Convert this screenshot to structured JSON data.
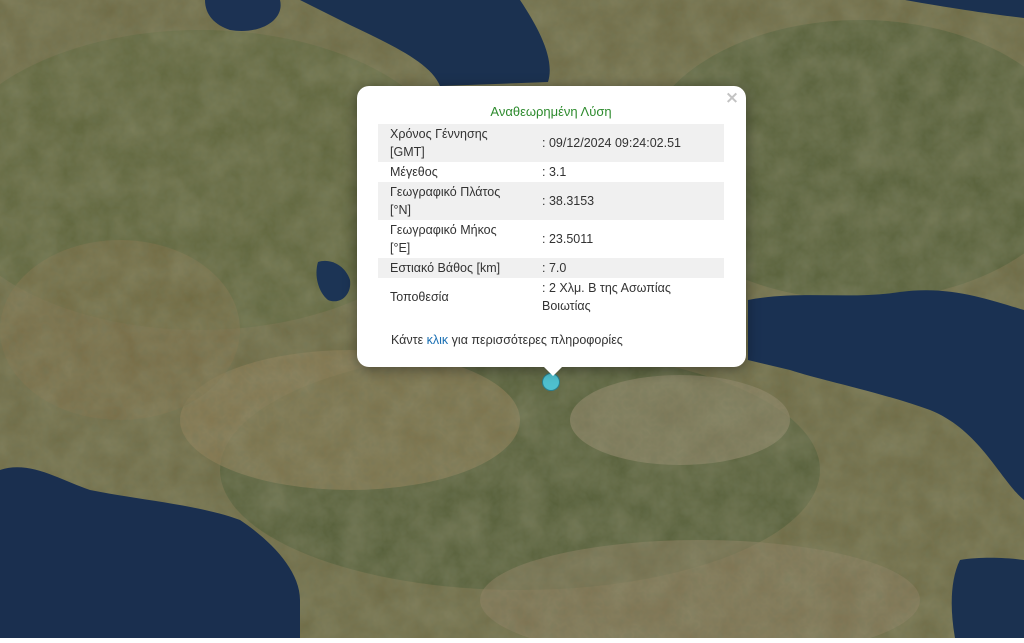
{
  "popup": {
    "title": "Αναθεωρημένη Λύση",
    "close_symbol": "×",
    "rows": [
      {
        "label": "Χρόνος Γέννησης [GMT]",
        "value": ": 09/12/2024 09:24:02.51"
      },
      {
        "label": "Μέγεθος",
        "value": ": 3.1"
      },
      {
        "label": "Γεωγραφικό Πλάτος [°N]",
        "value": ": 38.3153"
      },
      {
        "label": "Γεωγραφικό Μήκος [°E]",
        "value": ": 23.5011"
      },
      {
        "label": "Εστιακό Βάθος [km]",
        "value": ": 7.0"
      },
      {
        "label": "Τοποθεσία",
        "value": ": 2 Χλμ. Β της Ασωπίας Βοιωτίας"
      }
    ],
    "more_prefix": "Κάντε",
    "more_link": "κλικ",
    "more_suffix": "για περισσότερες πληροφορίες"
  },
  "colors": {
    "title": "#2e8b2e",
    "link": "#1a6fb3",
    "marker_fill": "#4fc0cf",
    "water": "#1b3150",
    "land": "#6e6a44"
  },
  "icons": {
    "marker": "epicenter-circle-icon",
    "close": "close-icon"
  }
}
